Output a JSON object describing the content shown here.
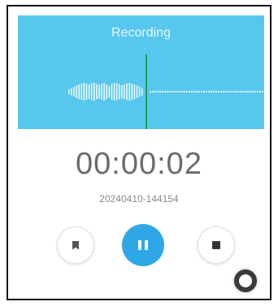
{
  "recorder": {
    "status_label": "Recording",
    "elapsed_time": "00:00:02",
    "file_name": "20240410-144154"
  },
  "controls": {
    "bookmark_icon": "bookmark-icon",
    "pause_icon": "pause-icon",
    "stop_icon": "stop-icon"
  },
  "colors": {
    "waveform_background": "#58c7ee",
    "playhead": "#1f9d55",
    "pause_button": "#2fa7e6"
  }
}
